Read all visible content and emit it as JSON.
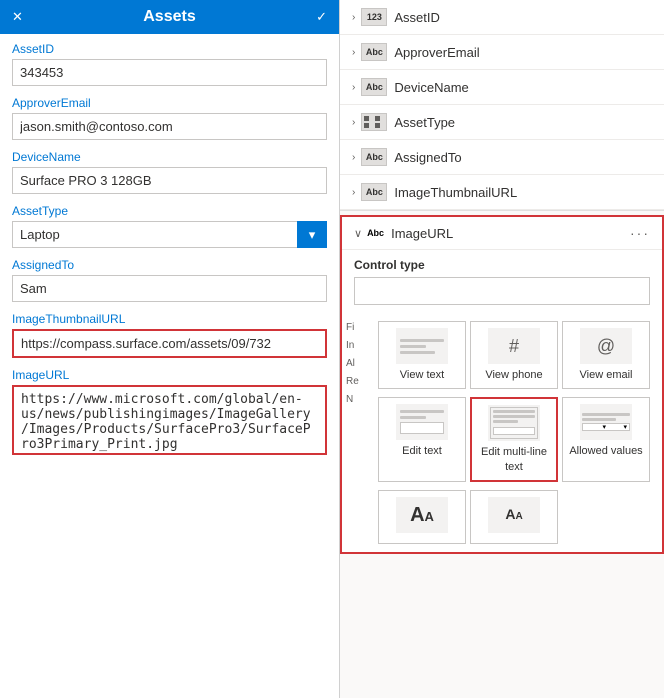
{
  "left": {
    "header": {
      "title": "Assets",
      "close_label": "✕",
      "check_label": "✓"
    },
    "fields": [
      {
        "id": "assetid",
        "label": "AssetID",
        "value": "343453",
        "type": "input"
      },
      {
        "id": "approveremail",
        "label": "ApproverEmail",
        "value": "jason.smith@contoso.com",
        "type": "input"
      },
      {
        "id": "devicename",
        "label": "DeviceName",
        "value": "Surface PRO 3 128GB",
        "type": "input"
      },
      {
        "id": "assettype",
        "label": "AssetType",
        "value": "Laptop",
        "type": "select"
      },
      {
        "id": "assignedto",
        "label": "AssignedTo",
        "value": "Sam",
        "type": "input"
      },
      {
        "id": "imagethumbnailurl",
        "label": "ImageThumbnailURL",
        "value": "https://compass.surface.com/assets/09/732",
        "type": "input",
        "highlighted": true
      },
      {
        "id": "imageurl",
        "label": "ImageURL",
        "value": "https://www.microsoft.com/global/en-us/news/publishingimages/ImageGallery/Images/Products/SurfacePro3/SurfacePro3Primary_Print.jpg",
        "type": "textarea",
        "highlighted": true
      }
    ]
  },
  "right": {
    "field_list": [
      {
        "id": "assetid",
        "name": "AssetID",
        "type_label": "123",
        "type_class": "num"
      },
      {
        "id": "approveremail",
        "name": "ApproverEmail",
        "type_label": "Abc",
        "type_class": "text"
      },
      {
        "id": "devicename",
        "name": "DeviceName",
        "type_label": "Abc",
        "type_class": "text"
      },
      {
        "id": "assettype",
        "name": "AssetType",
        "type_label": "grid",
        "type_class": "grid"
      },
      {
        "id": "assignedto",
        "name": "AssignedTo",
        "type_label": "Abc",
        "type_class": "text"
      },
      {
        "id": "imagethumbnailurl",
        "name": "ImageThumbnailURL",
        "type_label": "Abc",
        "type_class": "text"
      }
    ],
    "imageurl_section": {
      "name": "ImageURL",
      "type_label": "Abc",
      "dots": "···",
      "control_type_label": "Control type",
      "filter_text": "Fi\nIn\nAl\nRe\nN",
      "controls": [
        {
          "id": "view-text",
          "label": "View text",
          "type": "view-text"
        },
        {
          "id": "view-phone",
          "label": "View phone",
          "type": "view-phone"
        },
        {
          "id": "view-email",
          "label": "View email",
          "type": "view-email"
        },
        {
          "id": "edit-text",
          "label": "Edit text",
          "type": "edit-text"
        },
        {
          "id": "edit-multi-line-text",
          "label": "Edit multi-line text",
          "type": "edit-multiline",
          "selected": true
        },
        {
          "id": "allowed-values",
          "label": "Allowed values",
          "type": "allowed-values"
        }
      ],
      "bottom_controls": [
        {
          "id": "font-large",
          "label": "AA",
          "type": "font-large"
        },
        {
          "id": "font-small",
          "label": "AA",
          "type": "font-small"
        }
      ]
    }
  }
}
